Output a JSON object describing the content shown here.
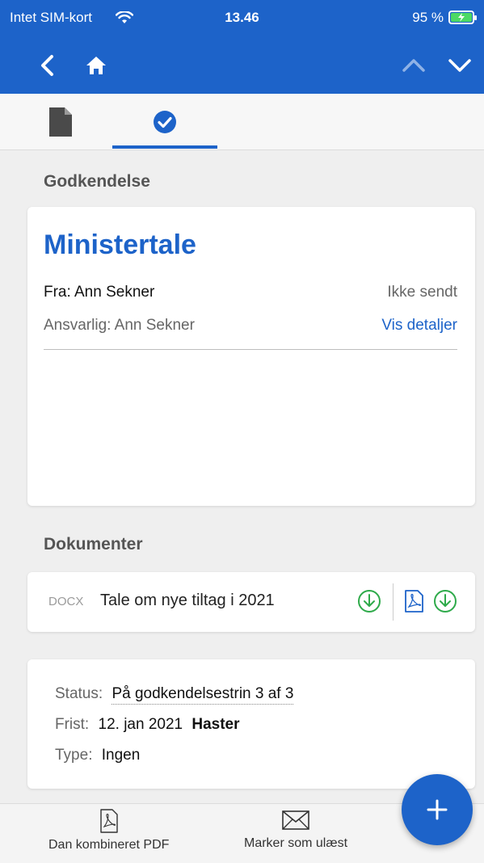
{
  "status_bar": {
    "carrier": "Intet SIM-kort",
    "time": "13.46",
    "battery": "95 %"
  },
  "navbar": {
    "icons": [
      "back-chevron-icon",
      "home-icon",
      "chevron-up-icon",
      "chevron-down-icon"
    ]
  },
  "tabs": {
    "active_index": 1,
    "icons": [
      "document-icon",
      "check-circle-icon"
    ]
  },
  "approval": {
    "section_title": "Godkendelse",
    "title": "Ministertale",
    "from": "Fra: Ann Sekner",
    "send_status": "Ikke sendt",
    "responsible": "Ansvarlig: Ann Sekner",
    "details_link": "Vis detaljer"
  },
  "documents": {
    "section_title": "Dokumenter",
    "items": [
      {
        "type": "DOCX",
        "name": "Tale om nye tiltag i 2021"
      }
    ]
  },
  "meta": {
    "status_label": "Status:",
    "status_value": "På godkendelsestrin 3 af 3",
    "deadline_label": "Frist:",
    "deadline_value": "12. jan 2021",
    "deadline_flag": "Haster",
    "type_label": "Type:",
    "type_value": "Ingen"
  },
  "bottom_bar": {
    "combined_pdf": "Dan kombineret PDF",
    "mark_unread": "Marker som ulæst"
  },
  "colors": {
    "brand": "#1d63c9",
    "download_green": "#2eaa4a",
    "background": "#efefef"
  }
}
